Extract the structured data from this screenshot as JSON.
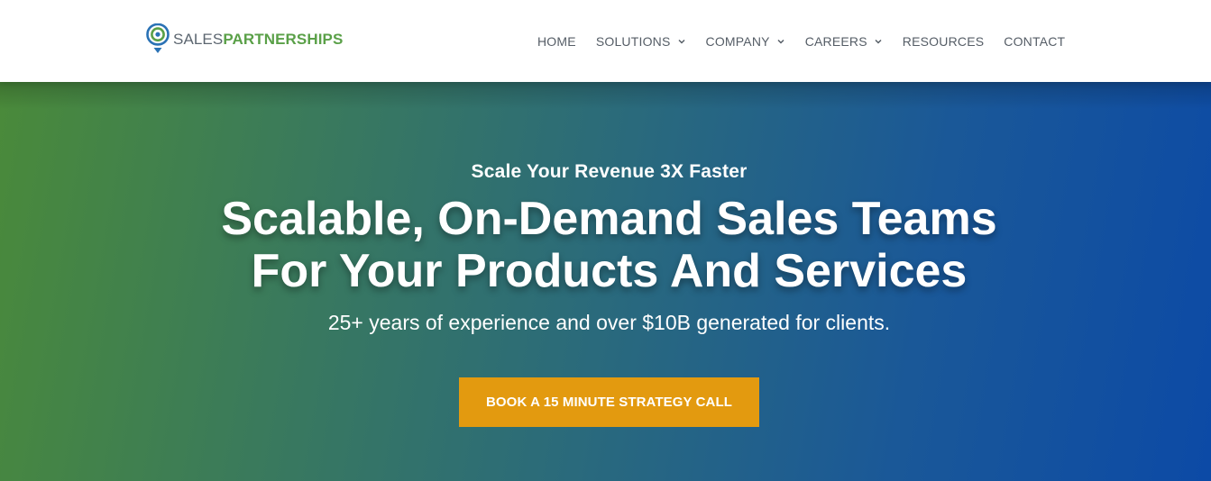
{
  "brand": {
    "name_part1": "SALES",
    "name_part2": "PARTNERSHIPS",
    "colors": {
      "gray": "#5c6670",
      "green": "#5aa048",
      "blue": "#2a72b5"
    }
  },
  "nav": {
    "items": [
      {
        "label": "HOME",
        "has_dropdown": false
      },
      {
        "label": "SOLUTIONS",
        "has_dropdown": true
      },
      {
        "label": "COMPANY",
        "has_dropdown": true
      },
      {
        "label": "CAREERS",
        "has_dropdown": true
      },
      {
        "label": "RESOURCES",
        "has_dropdown": false
      },
      {
        "label": "CONTACT",
        "has_dropdown": false
      }
    ]
  },
  "hero": {
    "eyebrow": "Scale Your Revenue 3X Faster",
    "headline_line1": "Scalable, On-Demand Sales Teams",
    "headline_line2": "For Your Products And Services",
    "subhead": "25+ years of experience and over $10B generated for clients.",
    "cta_label": "BOOK A 15 MINUTE STRATEGY CALL",
    "colors": {
      "gradient_start": "#4a8a3a",
      "gradient_end": "#0c4aa6",
      "cta": "#e39a0f"
    }
  },
  "icons": {
    "logo_mark": "location-pin-target-icon",
    "dropdown": "chevron-down-icon"
  }
}
